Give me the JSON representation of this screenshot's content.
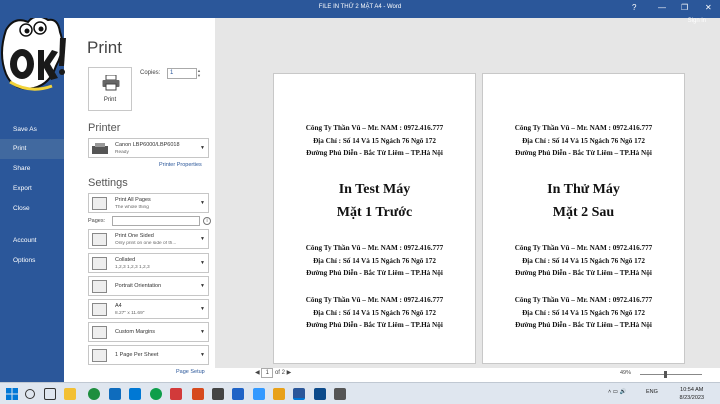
{
  "window": {
    "title": "FILE IN THỬ 2 MẶT  A4 - Word",
    "help": "?",
    "minimize": "—",
    "restore": "❐",
    "close": "✕",
    "sign_in": "Sign in"
  },
  "sidebar": {
    "back": "←",
    "items": [
      {
        "label": "Save As",
        "active": false
      },
      {
        "label": "Print",
        "active": true
      },
      {
        "label": "Share",
        "active": false
      },
      {
        "label": "Export",
        "active": false
      },
      {
        "label": "Close",
        "active": false
      },
      {
        "label": "Account",
        "active": false
      },
      {
        "label": "Options",
        "active": false
      }
    ]
  },
  "print": {
    "heading": "Print",
    "button_label": "Print",
    "copies_label": "Copies:",
    "copies_value": "1"
  },
  "printer": {
    "heading": "Printer",
    "name": "Canon LBP6000/LBP6018",
    "status": "Ready",
    "properties_link": "Printer Properties"
  },
  "settings": {
    "heading": "Settings",
    "print_what": {
      "main": "Print All Pages",
      "sub": "The whole thing"
    },
    "pages_label": "Pages:",
    "info": "i",
    "sides": {
      "main": "Print One Sided",
      "sub": "Only print on one side of th..."
    },
    "collation": {
      "main": "Collated",
      "sub": "1,2,3    1,2,3    1,2,3"
    },
    "orientation": {
      "main": "Portrait Orientation",
      "sub": ""
    },
    "paper": {
      "main": "A4",
      "sub": "8.27\" x 11.69\""
    },
    "margins": {
      "main": "Custom Margins",
      "sub": ""
    },
    "per_sheet": {
      "main": "1 Page Per Sheet",
      "sub": ""
    },
    "page_setup_link": "Page Setup"
  },
  "preview": {
    "page1": {
      "block1": [
        "Công Ty Thần Vũ – Mr. NAM : 0972.416.777",
        "Địa Chỉ : Số 14 Và 15  Ngách 76 Ngõ 172",
        "Đường Phú Diễn - Bắc Từ Liêm – TP.Hà Nội"
      ],
      "title": [
        "In Test Máy",
        "Mặt 1 Trước"
      ],
      "block2": [
        "Công Ty Thần Vũ – Mr. NAM : 0972.416.777",
        "Địa Chỉ : Số 14 Và 15  Ngách 76 Ngõ 172",
        "Đường Phú Diễn - Bắc Từ Liêm – TP.Hà Nội"
      ],
      "block3": [
        "Công Ty Thần Vũ – Mr. NAM : 0972.416.777",
        "Địa Chỉ : Số 14 Và 15  Ngách 76 Ngõ 172",
        "Đường Phú Diễn - Bắc Từ Liêm – TP.Hà Nội"
      ]
    },
    "page2": {
      "block1": [
        "Công Ty Thần Vũ – Mr. NAM : 0972.416.777",
        "Địa Chỉ : Số 14 Và 15  Ngách 76 Ngõ 172",
        "Đường Phú Diễn - Bắc Từ Liêm – TP.Hà Nội"
      ],
      "title": [
        "In Thử Máy",
        "Mặt 2 Sau"
      ],
      "block2": [
        "Công Ty Thần Vũ – Mr. NAM : 0972.416.777",
        "Địa Chỉ : Số 14 Và 15  Ngách 76 Ngõ 172",
        "Đường Phú Diễn - Bắc Từ Liêm – TP.Hà Nội"
      ],
      "block3": [
        "Công Ty Thần Vũ – Mr. NAM : 0972.416.777",
        "Địa Chỉ : Số 14 Và 15  Ngách 76 Ngõ 172",
        "Đường Phú Diễn - Bắc Từ Liêm – TP.Hà Nội"
      ]
    },
    "current_page": "1",
    "of_pages": "of 2",
    "zoom": "49%"
  },
  "taskbar": {
    "language": "ENG",
    "time": "10:54 AM",
    "date": "8/23/2023"
  },
  "colors": {
    "word_blue": "#2b579a",
    "sidebar_active": "#41699f",
    "preview_bg": "#e6e6e6"
  }
}
